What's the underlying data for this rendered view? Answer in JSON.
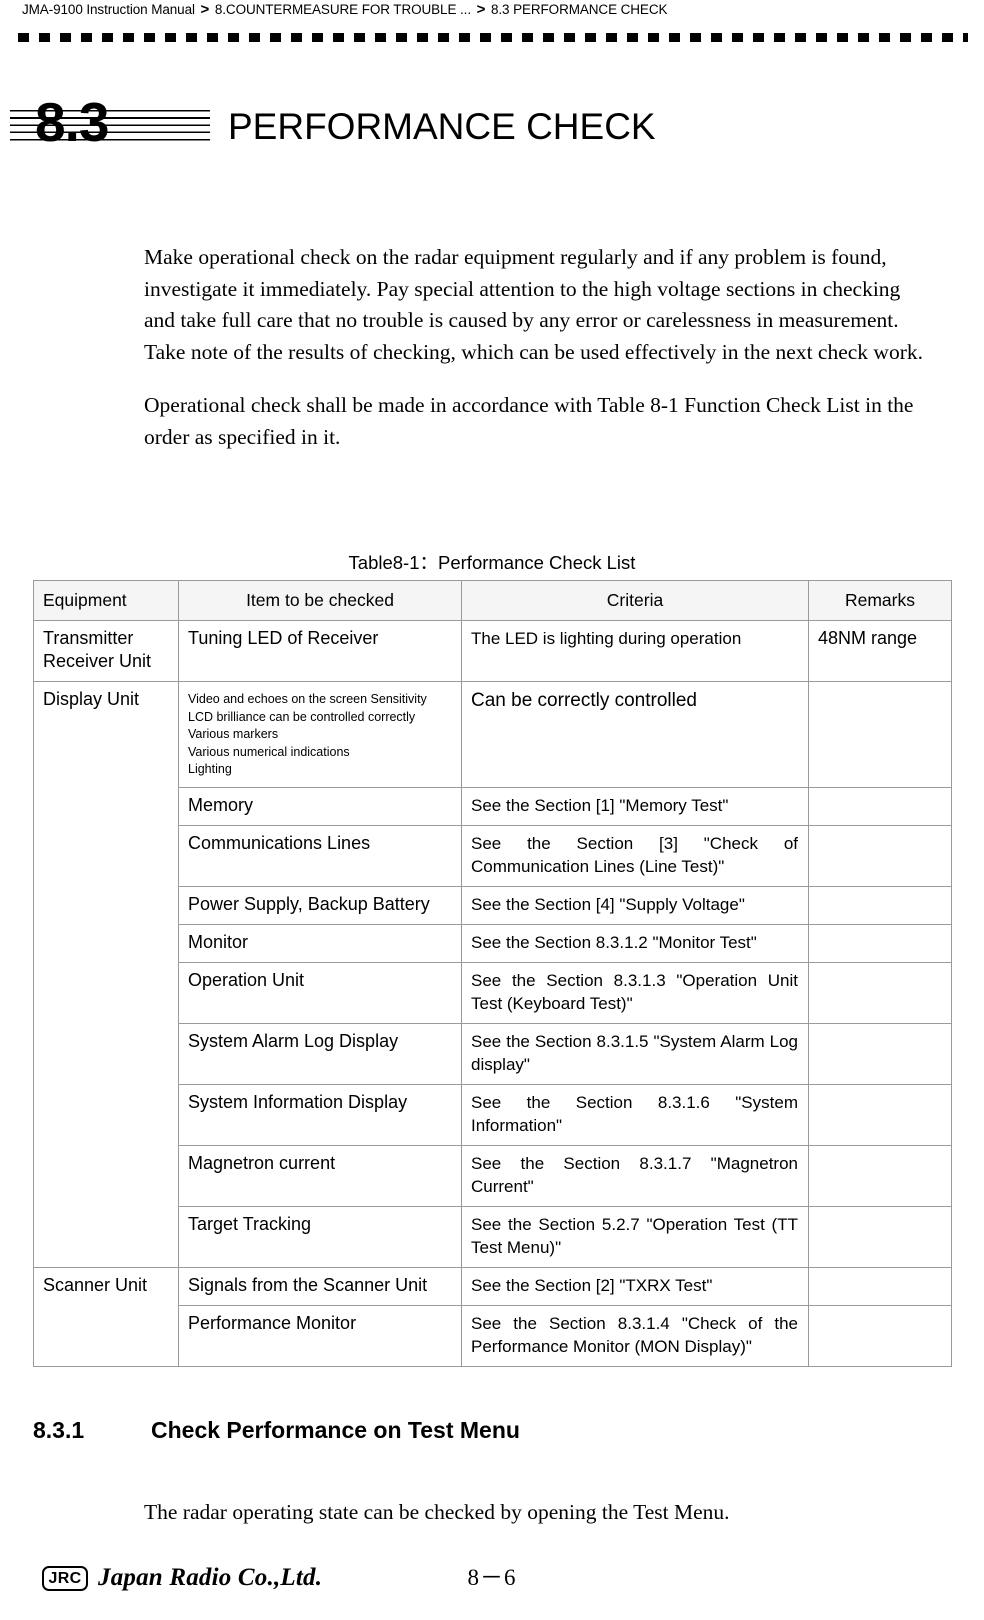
{
  "header": {
    "manual": "JMA-9100 Instruction Manual",
    "separator": ">",
    "chapter": "8.COUNTERMEASURE FOR TROUBLE ...",
    "section": "8.3  PERFORMANCE CHECK"
  },
  "section": {
    "number": "8.3",
    "title": "PERFORMANCE CHECK"
  },
  "body": {
    "paragraph1": "Make operational check on the radar equipment regularly and if any problem is found, investigate it immediately.  Pay special attention to the high voltage sections in checking and take full care that no trouble is caused by any error or carelessness in measurement. Take note of the results of checking, which can be used effectively in the next check work.",
    "paragraph2": "Operational check shall be made in accordance with Table 8-1 Function Check List in the order as specified in it."
  },
  "table": {
    "caption": "Table8-1：Performance Check List",
    "columns": [
      "Equipment",
      "Item to be checked",
      "Criteria",
      "Remarks"
    ],
    "rows": [
      {
        "equipment": "Transmitter\nReceiver Unit",
        "item": "Tuning LED of Receiver",
        "criteria": "The LED is lighting during operation",
        "remarks": "48NM range"
      },
      {
        "equipment": "Display Unit",
        "item_lines": [
          "Video and echoes on the screen Sensitivity",
          "LCD brilliance can be controlled correctly",
          "Various markers",
          "Various numerical indications",
          "Lighting"
        ],
        "criteria": "Can be correctly controlled",
        "remarks": ""
      },
      {
        "equipment": "",
        "item": "Memory",
        "criteria": "See the Section [1] \"Memory Test\"",
        "remarks": ""
      },
      {
        "equipment": "",
        "item": "Communications Lines",
        "criteria": "See the Section [3] \"Check of Communication Lines (Line Test)\"",
        "remarks": ""
      },
      {
        "equipment": "",
        "item": "Power Supply, Backup Battery",
        "criteria": "See the Section [4] \"Supply Voltage\"",
        "remarks": ""
      },
      {
        "equipment": "",
        "item": "Monitor",
        "criteria": "See the Section 8.3.1.2 \"Monitor Test\"",
        "remarks": ""
      },
      {
        "equipment": "",
        "item": "Operation Unit",
        "criteria": "See the Section 8.3.1.3 \"Operation Unit Test (Keyboard Test)\"",
        "remarks": ""
      },
      {
        "equipment": "",
        "item": "System Alarm Log Display",
        "criteria": "See the Section 8.3.1.5 \"System Alarm Log display\"",
        "remarks": ""
      },
      {
        "equipment": "",
        "item": "System Information Display",
        "criteria": "See the Section 8.3.1.6 \"System Information\"",
        "remarks": ""
      },
      {
        "equipment": "",
        "item": "Magnetron current",
        "criteria": "See the Section 8.3.1.7 \"Magnetron Current\"",
        "remarks": ""
      },
      {
        "equipment": "",
        "item": "Target Tracking",
        "criteria": "See the Section 5.2.7 \"Operation Test (TT Test Menu)\"",
        "remarks": ""
      },
      {
        "equipment": "Scanner Unit",
        "item": "Signals from the Scanner Unit",
        "criteria": "See the Section [2] \"TXRX Test\"",
        "remarks": ""
      },
      {
        "equipment": "",
        "item": "Performance Monitor",
        "criteria": "See the Section 8.3.1.4 \"Check of the Performance Monitor (MON Display)\"",
        "remarks": ""
      }
    ]
  },
  "subsection": {
    "number": "8.3.1",
    "title": "Check Performance on Test Menu",
    "paragraph": "The radar operating state can be checked by opening the Test Menu."
  },
  "footer": {
    "logo_mark": "JRC",
    "company": "Japan Radio Co.,Ltd.",
    "page": "8－6"
  }
}
